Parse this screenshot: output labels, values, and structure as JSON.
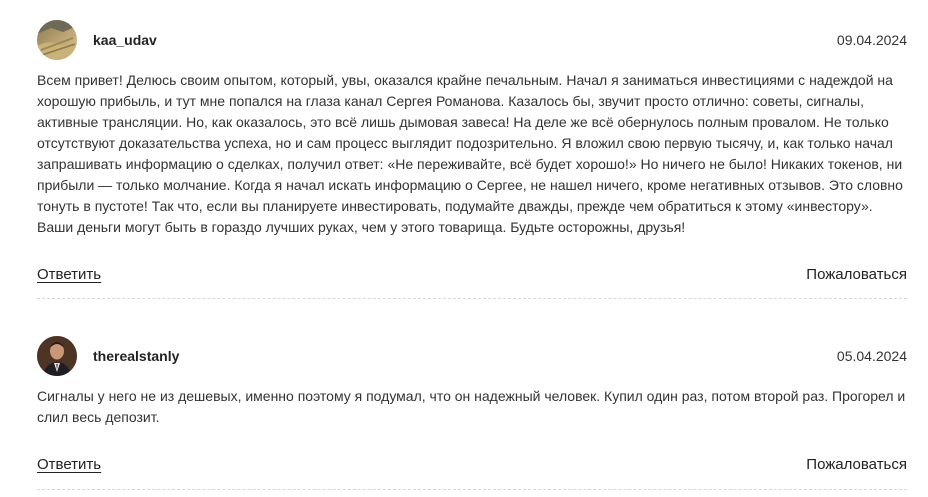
{
  "comments": [
    {
      "username": "kaa_udav",
      "date": "09.04.2024",
      "text": "Всем привет! Делюсь своим опытом, который, увы, оказался крайне печальным. Начал я заниматься инвестициями с надеждой на хорошую прибыль, и тут мне попался на глаза канал Сергея Романова. Казалось бы, звучит просто отлично: советы, сигналы, активные трансляции. Но, как оказалось, это всё лишь дымовая завеса! На деле же всё обернулось полным провалом. Не только отсутствуют доказательства успеха, но и сам процесс выглядит подозрительно. Я вложил свою первую тысячу, и, как только начал запрашивать информацию о сделках, получил ответ: «Не переживайте, всё будет хорошо!» Но ничего не было! Никаких токенов, ни прибыли — только молчание. Когда я начал искать информацию о Сергее, не нашел ничего, кроме негативных отзывов. Это словно тонуть в пустоте! Так что, если вы планируете инвестировать, подумайте дважды, прежде чем обратиться к этому «инвестору». Ваши деньги могут быть в гораздо лучших руках, чем у этого товарища. Будьте осторожны, друзья!",
      "reply_label": "Ответить",
      "report_label": "Пожаловаться",
      "avatar_icon": "landscape-photo-avatar"
    },
    {
      "username": "therealstanly",
      "date": "05.04.2024",
      "text": "Сигналы у него не из дешевых, именно поэтому я подумал, что он надежный человек. Купил один раз, потом второй раз. Прогорел и слил весь депозит.",
      "reply_label": "Ответить",
      "report_label": "Пожаловаться",
      "avatar_icon": "man-in-suit-avatar"
    }
  ]
}
